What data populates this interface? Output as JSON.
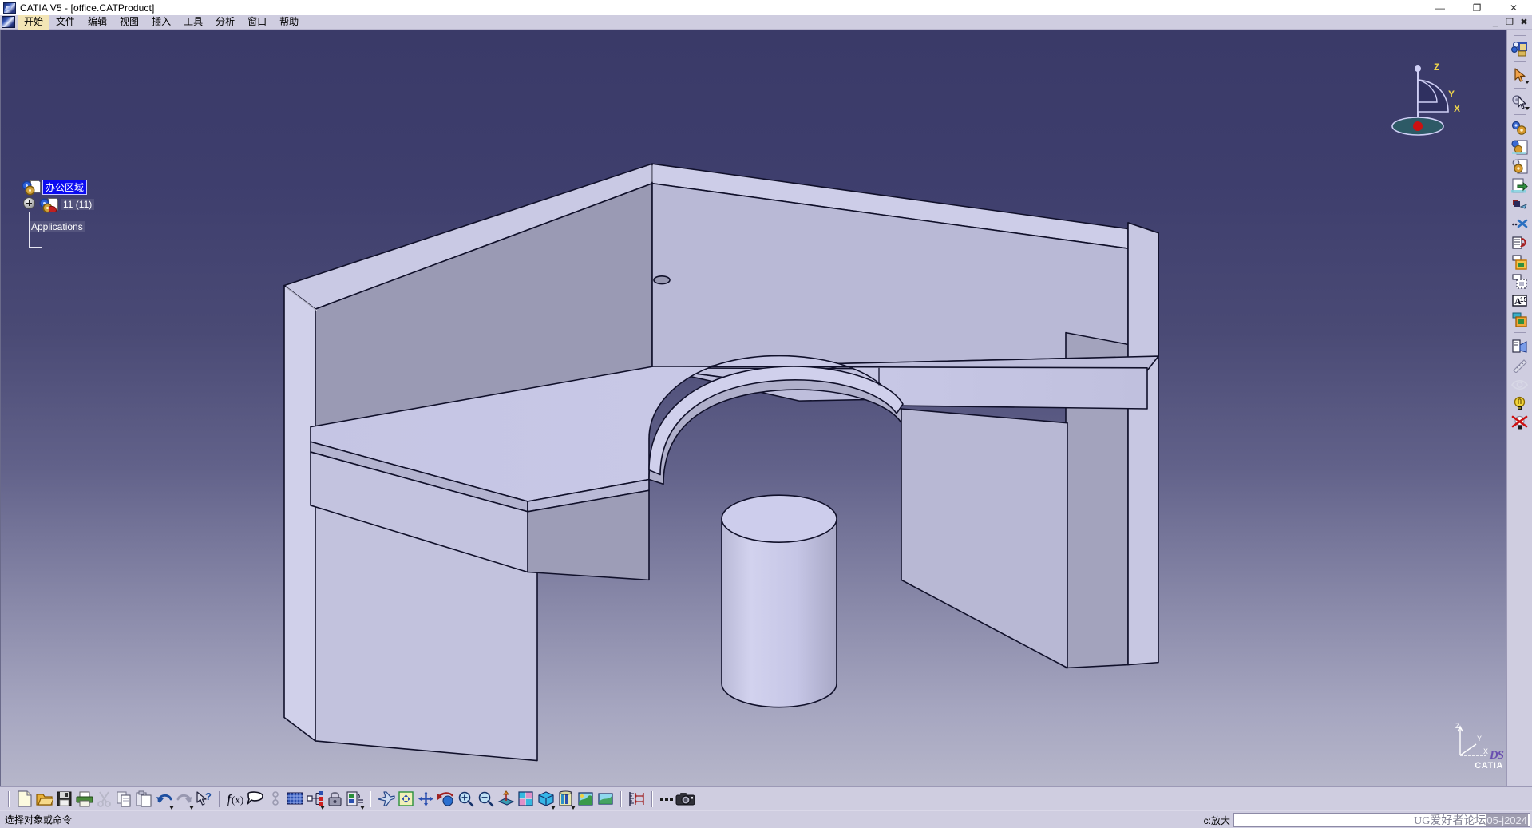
{
  "window": {
    "title": "CATIA V5 - [office.CATProduct]",
    "app_icon": "catia-logo-icon",
    "controls": [
      {
        "name": "minimize-button",
        "glyph": "—"
      },
      {
        "name": "restore-button",
        "glyph": "❐"
      },
      {
        "name": "close-button",
        "glyph": "✕"
      }
    ],
    "inner_controls": [
      {
        "name": "inner-minimize-button",
        "glyph": "_"
      },
      {
        "name": "inner-restore-button",
        "glyph": "❐"
      },
      {
        "name": "inner-close-button",
        "glyph": "✖"
      }
    ]
  },
  "menubar": {
    "items": [
      {
        "label": "开始",
        "name": "menu-start",
        "active": true
      },
      {
        "label": "文件",
        "name": "menu-file",
        "active": false
      },
      {
        "label": "编辑",
        "name": "menu-edit",
        "active": false
      },
      {
        "label": "视图",
        "name": "menu-view",
        "active": false
      },
      {
        "label": "插入",
        "name": "menu-insert",
        "active": false
      },
      {
        "label": "工具",
        "name": "menu-tools",
        "active": false
      },
      {
        "label": "分析",
        "name": "menu-analyze",
        "active": false
      },
      {
        "label": "窗口",
        "name": "menu-window",
        "active": false
      },
      {
        "label": "帮助",
        "name": "menu-help",
        "active": false
      }
    ]
  },
  "spec_tree": {
    "root": {
      "label": "办公区域",
      "selected": true,
      "icon": "product-icon"
    },
    "child": {
      "label": "11 (11)",
      "selected": false,
      "icon": "part-instance-icon"
    },
    "applications": {
      "label": "Applications",
      "selected": false
    }
  },
  "viewport": {
    "compass": {
      "z": "Z",
      "y": "Y",
      "x": "X"
    },
    "tripod": {
      "z": "Z",
      "y": "Y",
      "x": "X"
    },
    "background_top": "#3a3a68",
    "background_bottom": "#b3b3c8",
    "model": {
      "name": "office-workstation-desk",
      "face_light": "#c9c9e6",
      "face_mid": "#b6b6d2",
      "face_dark": "#9b9bb4",
      "edge": "#111122",
      "trash_bin": "#c8c8e4"
    }
  },
  "right_toolbar": {
    "items": [
      {
        "name": "product-structure-icon",
        "label": "Product Structure"
      },
      {
        "name": "select-arrow-icon",
        "label": "选择",
        "caret": true
      },
      {
        "name": "select-gear-icon",
        "label": "Selection Tools",
        "caret": true
      },
      {
        "name": "component-gears-icon",
        "label": "Existing Component"
      },
      {
        "name": "new-part-icon",
        "label": "New Part"
      },
      {
        "name": "new-product-icon",
        "label": "New Product"
      },
      {
        "name": "replace-component-icon",
        "label": "Replace Component"
      },
      {
        "name": "copy-paste-icon",
        "label": "Graph Tree Reordering"
      },
      {
        "name": "fast-multi-instance-icon",
        "label": "Fast Multi Instantiation"
      },
      {
        "name": "reorder-icon",
        "label": "Generate Numbering"
      },
      {
        "name": "selective-load-icon",
        "label": "Selective Load"
      },
      {
        "name": "manage-representations-icon",
        "label": "Manage Representations"
      },
      {
        "name": "annotation-icon",
        "label": "Annotation"
      },
      {
        "name": "apply-material-icon",
        "label": "Apply Material"
      },
      {
        "name": "catalog-browser-icon",
        "label": "Catalog Browser"
      },
      {
        "name": "measure-ruler-icon",
        "label": "Measure"
      },
      {
        "name": "hide-show-icon",
        "label": "Hide/Show"
      },
      {
        "name": "light-on-icon",
        "label": "Lighting"
      },
      {
        "name": "light-off-icon",
        "label": "No Lighting"
      }
    ]
  },
  "bottom_toolbar": {
    "groups": [
      {
        "name": "standard-group",
        "items": [
          {
            "name": "new-file-icon",
            "label": "新建"
          },
          {
            "name": "open-file-icon",
            "label": "打开"
          },
          {
            "name": "save-icon",
            "label": "保存"
          },
          {
            "name": "print-icon",
            "label": "打印"
          },
          {
            "name": "cut-icon",
            "label": "剪切"
          },
          {
            "name": "copy-icon",
            "label": "复制"
          },
          {
            "name": "paste-icon",
            "label": "粘贴"
          },
          {
            "name": "undo-icon",
            "label": "撤消",
            "caret": true
          },
          {
            "name": "redo-icon",
            "label": "重做",
            "caret": true
          },
          {
            "name": "whats-this-icon",
            "label": "What's This"
          }
        ]
      },
      {
        "name": "tools-group",
        "items": [
          {
            "name": "formula-icon",
            "label": "f(x) Formula"
          },
          {
            "name": "comment-icon",
            "label": "Comment"
          },
          {
            "name": "constraint-icon",
            "label": "Constraint"
          },
          {
            "name": "grid-icon",
            "label": "Grid"
          },
          {
            "name": "graph-tree-icon",
            "label": "Graph Tree",
            "caret": true
          },
          {
            "name": "lock-icon",
            "label": "Lock"
          },
          {
            "name": "bom-icon",
            "label": "Bill Of Material",
            "caret": true
          }
        ]
      },
      {
        "name": "view-group",
        "items": [
          {
            "name": "fly-mode-icon",
            "label": "Fly Mode"
          },
          {
            "name": "fit-all-in-icon",
            "label": "Fit All In"
          },
          {
            "name": "pan-icon",
            "label": "Pan"
          },
          {
            "name": "rotate-icon",
            "label": "Rotate"
          },
          {
            "name": "zoom-in-icon",
            "label": "Zoom In"
          },
          {
            "name": "zoom-out-icon",
            "label": "Zoom Out"
          },
          {
            "name": "normal-view-icon",
            "label": "Normal View"
          },
          {
            "name": "multi-view-icon",
            "label": "Multi View"
          },
          {
            "name": "isometric-view-icon",
            "label": "Isometric View",
            "caret": true
          },
          {
            "name": "render-style-icon",
            "label": "Shading With Edges",
            "caret": true
          },
          {
            "name": "apply-scene-icon",
            "label": "Apply Scene"
          },
          {
            "name": "hide-show-view-icon",
            "label": "Hide/Show"
          }
        ]
      },
      {
        "name": "measure-group",
        "items": [
          {
            "name": "measure-between-icon",
            "label": "Measure Between"
          },
          {
            "name": "more-options-icon",
            "label": "..."
          },
          {
            "name": "camera-icon",
            "label": "Camera"
          }
        ]
      }
    ]
  },
  "statusbar": {
    "message": "选择对象或命令",
    "power_input_label": "c:放大",
    "power_input_value": "",
    "watermark_text": "UG爱好者论坛",
    "watermark_overlay": "05-j2024",
    "logo_ds": "DS",
    "logo_name": "CATIA"
  }
}
